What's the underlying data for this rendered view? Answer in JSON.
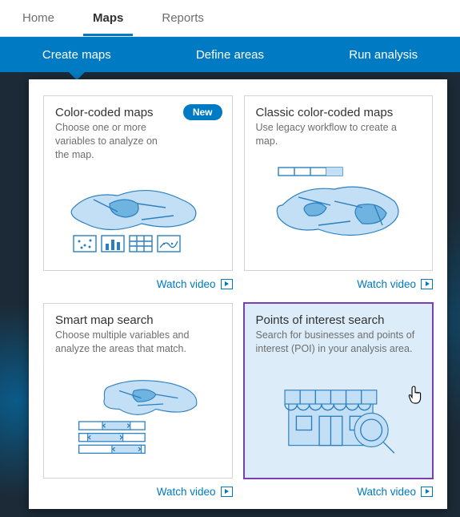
{
  "topbar": {
    "tabs": [
      {
        "label": "Home"
      },
      {
        "label": "Maps"
      },
      {
        "label": "Reports"
      }
    ],
    "active_index": 1
  },
  "ribbon": {
    "items": [
      {
        "label": "Create maps"
      },
      {
        "label": "Define areas"
      },
      {
        "label": "Run analysis"
      }
    ],
    "active_index": 0
  },
  "cards": {
    "color_coded": {
      "title": "Color-coded maps",
      "desc": "Choose one or more variables to analyze on the map.",
      "badge": "New",
      "watch": "Watch video"
    },
    "classic": {
      "title": "Classic color-coded maps",
      "desc": "Use legacy workflow to create a map.",
      "watch": "Watch video"
    },
    "smart": {
      "title": "Smart map search",
      "desc": "Choose multiple variables and analyze the areas that match.",
      "watch": "Watch video"
    },
    "poi": {
      "title": "Points of interest search",
      "desc": "Search for businesses and points of interest (POI) in your analysis area.",
      "watch": "Watch video"
    }
  }
}
